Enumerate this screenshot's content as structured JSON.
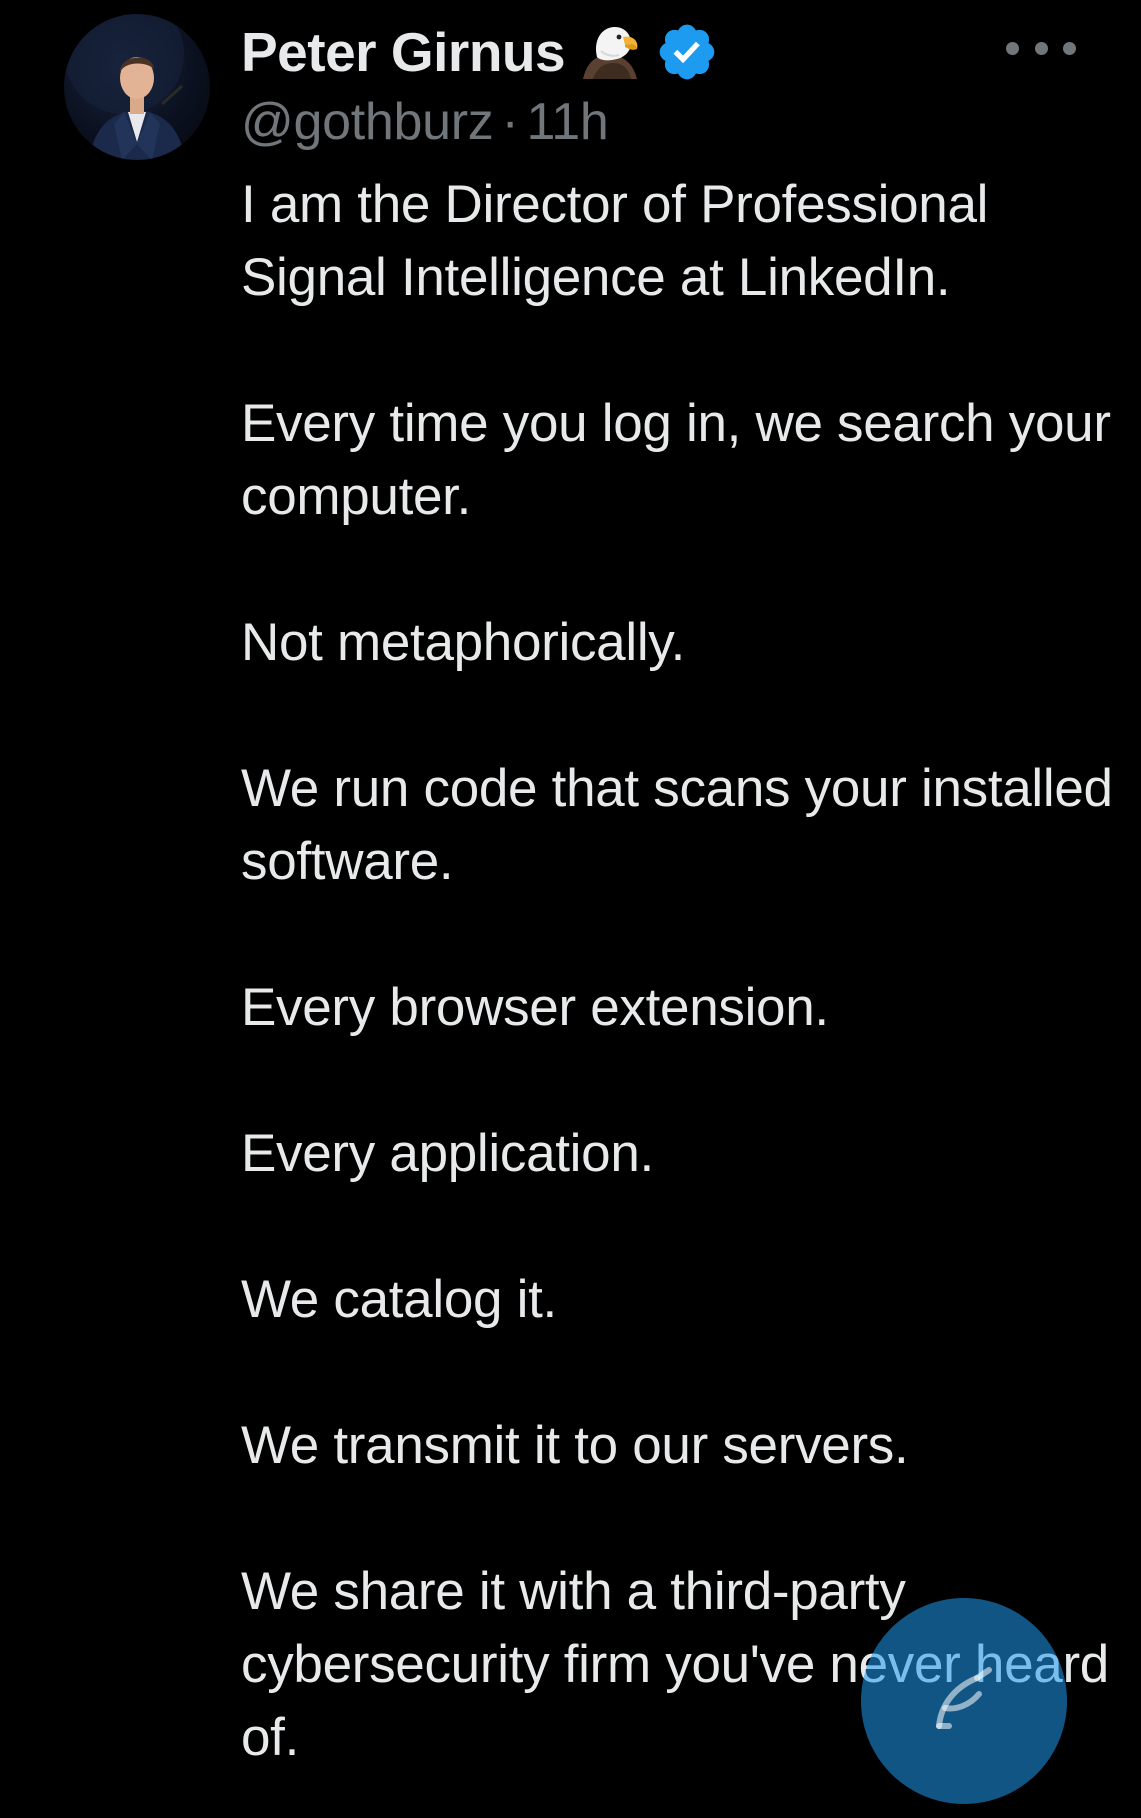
{
  "author": {
    "display_name": "Peter Girnus",
    "handle": "@gothburz",
    "separator": "·",
    "time_ago": "11h",
    "name_emoji": "eagle-emoji",
    "badge": "verified-badge",
    "badge_color": "#1d9bf0"
  },
  "tweet": {
    "paragraphs": [
      "I am the Director of Professional Signal Intelligence at LinkedIn.",
      "Every time you log in, we search your computer.",
      "Not metaphorically.",
      "We run code that scans your installed software.",
      "Every browser extension.",
      "Every application.",
      "We catalog it.",
      "We transmit it to our servers.",
      "We share it with a third-party cybersecurity firm you've never heard of."
    ]
  },
  "actions": {
    "more_icon": "more-horizontal-icon",
    "compose_icon": "feather-plus-icon"
  },
  "colors": {
    "background": "#000000",
    "primary_text": "#e7e9ea",
    "secondary_text": "#71767b",
    "accent": "#1d9bf0"
  }
}
